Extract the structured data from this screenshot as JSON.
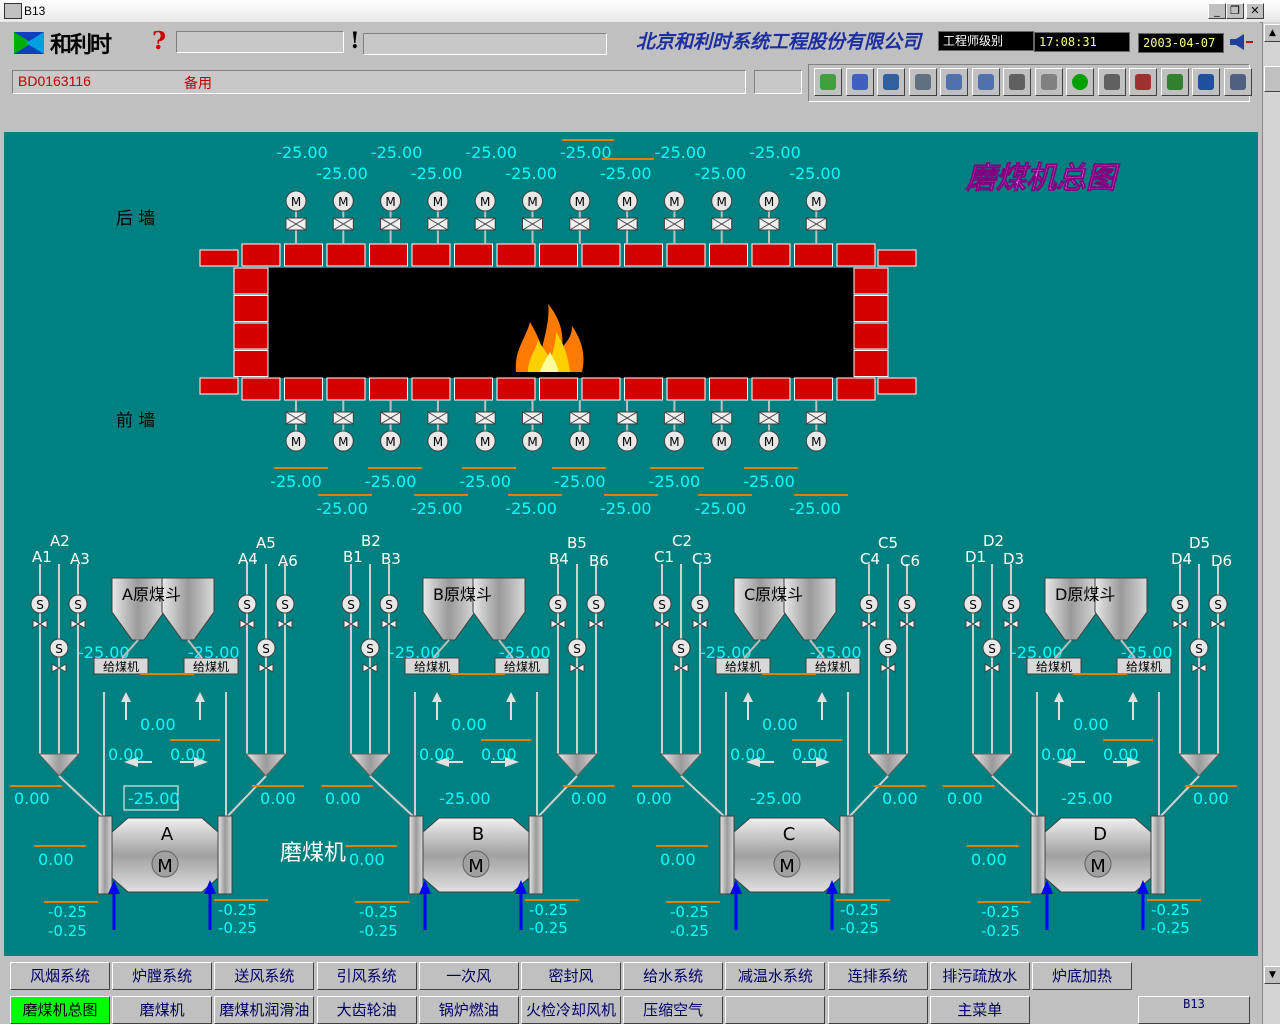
{
  "window": {
    "title": "B13"
  },
  "header": {
    "logo_text": "和利时",
    "company": "北京和利时系统工程股份有限公司",
    "user_level": "工程师级别",
    "time": "17:08:31",
    "date": "2003-04-07"
  },
  "status": {
    "id": "BD0163116",
    "text": "备用"
  },
  "toolbar_icons": [
    "globe-check-icon",
    "home-icon",
    "bus-icon",
    "back-icon",
    "page-prev-icon",
    "page-next-icon",
    "copy-icon",
    "clock-icon",
    "green-dot-icon",
    "alarm-list-icon",
    "alarm-clear-icon",
    "alarm-ack-icon",
    "trend-icon",
    "report-icon"
  ],
  "diagram": {
    "title": "磨煤机总图",
    "rear_wall": "后  墙",
    "front_wall": "前  墙",
    "label_mill_text": "磨煤机",
    "top_row1": [
      "-25.00",
      "-25.00",
      "-25.00",
      "-25.00",
      "-25.00",
      "-25.00"
    ],
    "top_row2": [
      "-25.00",
      "-25.00",
      "-25.00",
      "-25.00",
      "-25.00",
      "-25.00"
    ],
    "bottom_row1": [
      "-25.00",
      "-25.00",
      "-25.00",
      "-25.00",
      "-25.00",
      "-25.00"
    ],
    "bottom_row2": [
      "-25.00",
      "-25.00",
      "-25.00",
      "-25.00",
      "-25.00",
      "-25.00"
    ],
    "burner_motor_label": "M",
    "mills": [
      {
        "letter": "A",
        "bunker": "A原煤斗",
        "labels": [
          "A1",
          "A2",
          "A3",
          "A4",
          "A5",
          "A6"
        ],
        "feeder": "给煤机",
        "feeder_l": "-25.00",
        "feeder_r": "-25.00",
        "flow_c": "0.00",
        "flow_l": "0.00",
        "flow_r": "0.00",
        "left_out": "0.00",
        "center": "-25.00",
        "right_out": "0.00",
        "mid_left": "0.00",
        "lower_l1": "-0.25",
        "lower_l2": "-0.25",
        "lower_r1": "-0.25",
        "lower_r2": "-0.25"
      },
      {
        "letter": "B",
        "bunker": "B原煤斗",
        "labels": [
          "B1",
          "B2",
          "B3",
          "B4",
          "B5",
          "B6"
        ],
        "feeder": "给煤机",
        "feeder_l": "-25.00",
        "feeder_r": "-25.00",
        "flow_c": "0.00",
        "flow_l": "0.00",
        "flow_r": "0.00",
        "left_out": "0.00",
        "center": "-25.00",
        "right_out": "0.00",
        "mid_left": "0.00",
        "lower_l1": "-0.25",
        "lower_l2": "-0.25",
        "lower_r1": "-0.25",
        "lower_r2": "-0.25"
      },
      {
        "letter": "C",
        "bunker": "C原煤斗",
        "labels": [
          "C1",
          "C2",
          "C3",
          "C4",
          "C5",
          "C6"
        ],
        "feeder": "给煤机",
        "feeder_l": "-25.00",
        "feeder_r": "-25.00",
        "flow_c": "0.00",
        "flow_l": "0.00",
        "flow_r": "0.00",
        "left_out": "0.00",
        "center": "-25.00",
        "right_out": "0.00",
        "mid_left": "0.00",
        "lower_l1": "-0.25",
        "lower_l2": "-0.25",
        "lower_r1": "-0.25",
        "lower_r2": "-0.25"
      },
      {
        "letter": "D",
        "bunker": "D原煤斗",
        "labels": [
          "D1",
          "D2",
          "D3",
          "D4",
          "D5",
          "D6"
        ],
        "feeder": "给煤机",
        "feeder_l": "-25.00",
        "feeder_r": "-25.00",
        "flow_c": "0.00",
        "flow_l": "0.00",
        "flow_r": "0.00",
        "left_out": "0.00",
        "center": "-25.00",
        "right_out": "0.00",
        "mid_left": "0.00",
        "lower_l1": "-0.25",
        "lower_l2": "-0.25",
        "lower_r1": "-0.25",
        "lower_r2": "-0.25"
      }
    ]
  },
  "nav": {
    "row1": [
      "风烟系统",
      "炉膛系统",
      "送风系统",
      "引风系统",
      "一次风",
      "密封风",
      "给水系统",
      "减温水系统",
      "连排系统",
      "排污疏放水",
      "炉底加热"
    ],
    "row2": [
      "磨煤机总图",
      "磨煤机",
      "磨煤机润滑油",
      "大齿轮油",
      "锅炉燃油",
      "火检冷却风机",
      "压缩空气",
      "",
      "",
      "主菜单"
    ],
    "page_code": "B13"
  },
  "colors": {
    "panel": "#008080",
    "value": "#00ffff",
    "title": "#ff66ff",
    "brick": "#d40000",
    "accent_line": "#e08000"
  }
}
